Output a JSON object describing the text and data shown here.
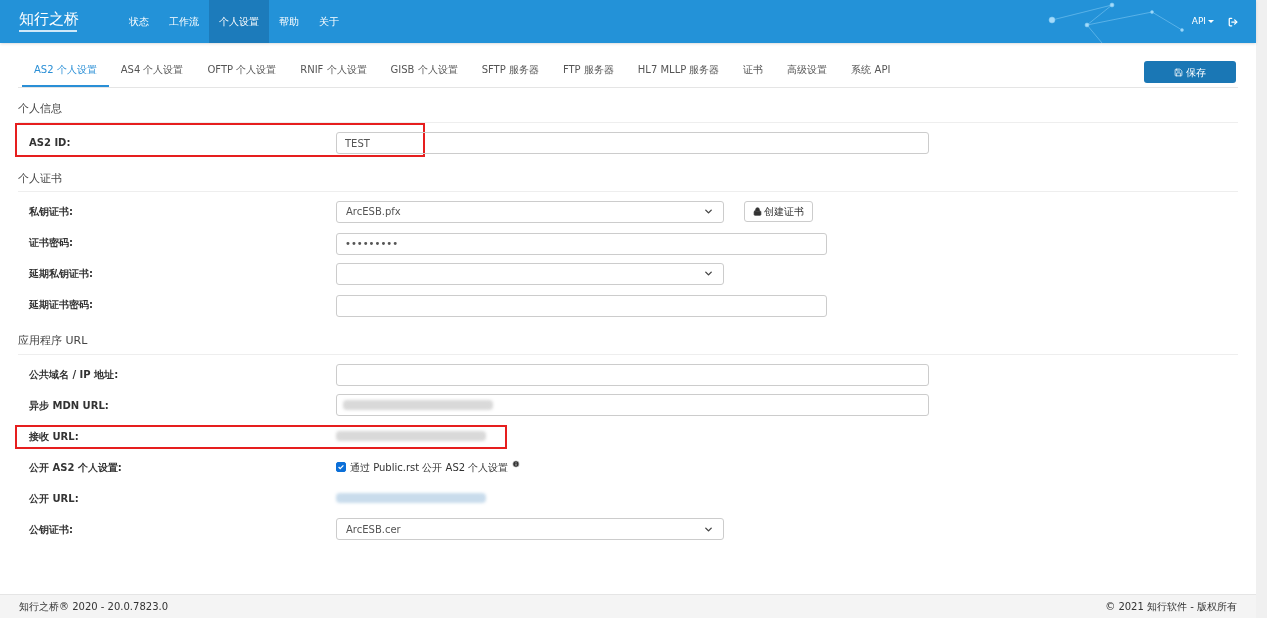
{
  "header": {
    "logo": "知行之桥",
    "nav": [
      {
        "label": "状态",
        "selected": false
      },
      {
        "label": "工作流",
        "selected": false
      },
      {
        "label": "个人设置",
        "selected": true
      },
      {
        "label": "帮助",
        "selected": false
      },
      {
        "label": "关于",
        "selected": false
      }
    ],
    "api_menu": "API"
  },
  "tabs": [
    {
      "label": "AS2 个人设置",
      "selected": true
    },
    {
      "label": "AS4 个人设置",
      "selected": false
    },
    {
      "label": "OFTP 个人设置",
      "selected": false
    },
    {
      "label": "RNIF 个人设置",
      "selected": false
    },
    {
      "label": "GISB 个人设置",
      "selected": false
    },
    {
      "label": "SFTP 服务器",
      "selected": false
    },
    {
      "label": "FTP 服务器",
      "selected": false
    },
    {
      "label": "HL7 MLLP 服务器",
      "selected": false
    },
    {
      "label": "证书",
      "selected": false
    },
    {
      "label": "高级设置",
      "selected": false
    },
    {
      "label": "系统 API",
      "selected": false
    }
  ],
  "save_button": "保存",
  "sections": [
    {
      "title": "个人信息",
      "fields": [
        {
          "kind": "text",
          "label": "AS2 ID:",
          "value": "TEST",
          "highlighted": true
        }
      ]
    },
    {
      "title": "个人证书",
      "fields": [
        {
          "kind": "select",
          "label": "私钥证书:",
          "value": "ArcESB.pfx",
          "button": "创建证书",
          "highlighted": false
        },
        {
          "kind": "password",
          "label": "证书密码:",
          "value": "•••••••••",
          "highlighted": false
        },
        {
          "kind": "select",
          "label": "延期私钥证书:",
          "highlighted": false
        },
        {
          "kind": "password",
          "label": "延期证书密码:",
          "highlighted": false
        }
      ]
    },
    {
      "title": "应用程序 URL",
      "fields": [
        {
          "kind": "text",
          "label": "公共域名 / IP 地址:",
          "highlighted": false
        },
        {
          "kind": "redacted_input",
          "label": "异步 MDN URL:",
          "highlighted": false
        },
        {
          "kind": "redacted_text",
          "label": "接收 URL:",
          "highlighted": true
        },
        {
          "kind": "checkbox",
          "label": "公开 AS2 个人设置:",
          "checked": true,
          "text": "通过 Public.rst 公开 AS2 个人设置",
          "highlighted": false
        },
        {
          "kind": "redacted_link",
          "label": "公开 URL:",
          "highlighted": false
        },
        {
          "kind": "select",
          "label": "公钥证书:",
          "value": "ArcESB.cer",
          "highlighted": false
        }
      ]
    }
  ],
  "footer": {
    "left": "知行之桥® 2020 - 20.0.7823.0",
    "right": "© 2021 知行软件 - 版权所有"
  }
}
